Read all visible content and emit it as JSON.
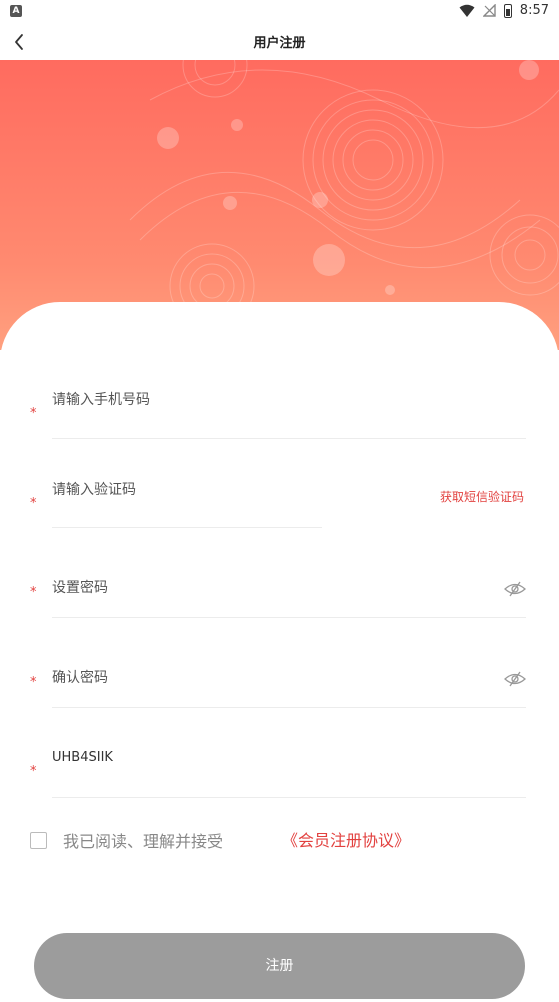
{
  "status_bar": {
    "time": "8:57",
    "notif_icon_letter": "A"
  },
  "header": {
    "title": "用户注册"
  },
  "form": {
    "required_mark": "*",
    "phone_placeholder": "请输入手机号码",
    "code_placeholder": "请输入验证码",
    "sms_button": "获取短信验证码",
    "password_placeholder": "设置密码",
    "confirm_placeholder": "确认密码",
    "invite_code_value": "UHB4SIIK"
  },
  "agreement": {
    "text": "我已阅读、理解并接受",
    "link": "《会员注册协议》",
    "checked": false
  },
  "submit": {
    "label": "注册"
  },
  "colors": {
    "accent": "#e2413f",
    "banner_top": "#ff6b5f",
    "banner_bottom": "#ffa07f",
    "button_disabled": "#9c9c9c"
  }
}
